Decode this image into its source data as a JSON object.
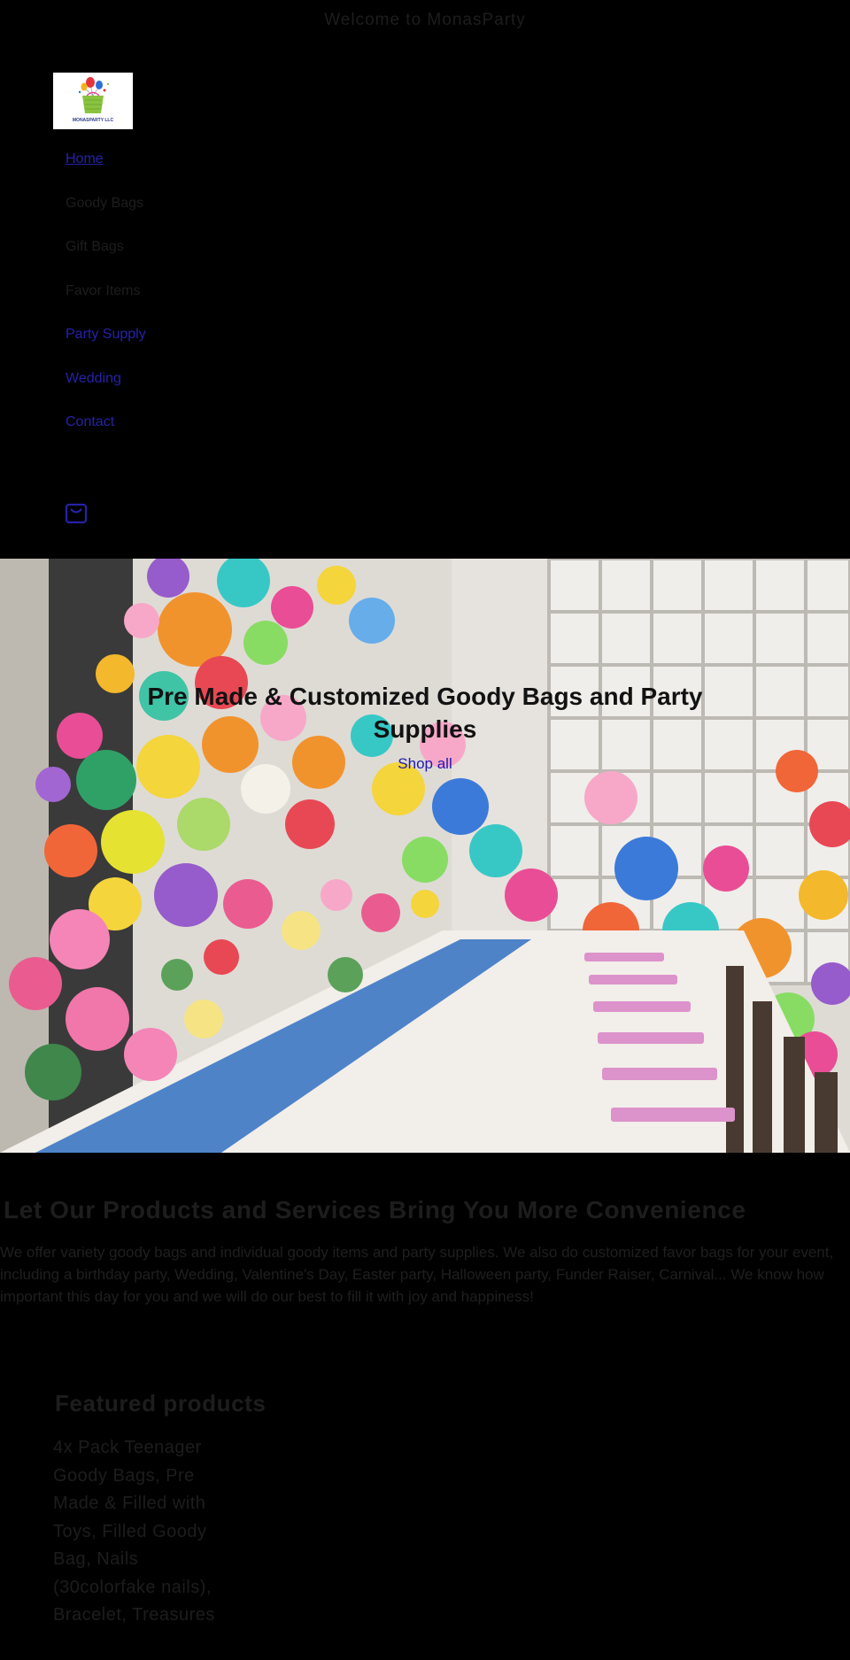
{
  "announcement": "Welcome to MonasParty",
  "brand": {
    "logo_text": "MONASPARTY LLC",
    "logo_icon": "balloon-gift-bag-logo"
  },
  "nav": {
    "items": [
      {
        "label": "Home"
      },
      {
        "label": "Goody Bags"
      },
      {
        "label": "Gift Bags"
      },
      {
        "label": "Favor Items"
      },
      {
        "label": "Party Supply"
      },
      {
        "label": "Wedding"
      },
      {
        "label": "Contact"
      }
    ]
  },
  "header": {
    "cart_icon": "shopping-bag-icon"
  },
  "hero": {
    "title": "Pre Made & Customized Goody Bags and Party Supplies",
    "cta": "Shop all"
  },
  "intro": {
    "title": "Let Our Products and Services Bring You More Convenience",
    "text": "We offer variety goody bags and individual goody items and party supplies. We also do customized favor bags for your event, including a birthday party, Wedding, Valentine's Day, Easter party, Halloween party, Funder Raiser, Carnival... We know how important this day for you and we will do our best to fill it with joy and happiness!"
  },
  "featured": {
    "title": "Featured products",
    "products": [
      {
        "title": "4x Pack Teenager Goody Bags, Pre Made & Filled with Toys, Filled Goody Bag, Nails (30colorfake nails), Bracelet, Treasures"
      }
    ]
  },
  "colors": {
    "background": "#000000",
    "link": "#2622a8",
    "cta": "#1e19b3"
  }
}
